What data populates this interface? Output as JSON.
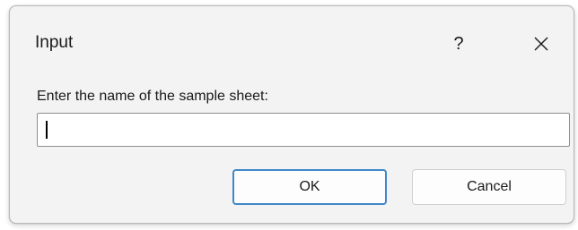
{
  "dialog": {
    "title": "Input",
    "help_label": "?",
    "prompt": "Enter the name of the sample sheet:",
    "input_value": "",
    "ok_label": "OK",
    "cancel_label": "Cancel"
  },
  "icons": {
    "close": "close-icon"
  },
  "colors": {
    "dialog_background": "#f3f3f3",
    "default_button_border": "#3f88c9",
    "input_border": "#8f8f8f"
  }
}
